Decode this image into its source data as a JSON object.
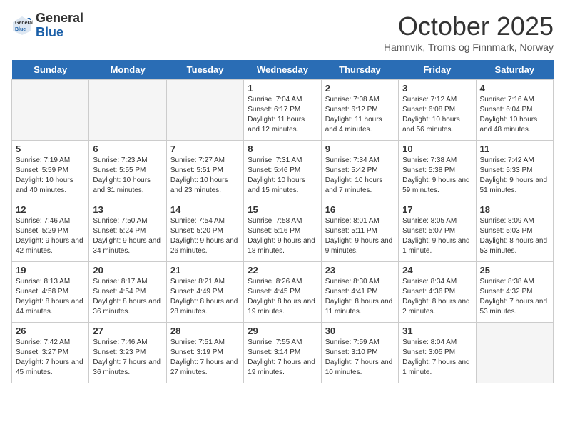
{
  "app": {
    "name": "GeneralBlue",
    "logo_text_line1": "General",
    "logo_text_line2": "Blue"
  },
  "header": {
    "month_title": "October 2025",
    "subtitle": "Hamnvik, Troms og Finnmark, Norway"
  },
  "weekdays": [
    "Sunday",
    "Monday",
    "Tuesday",
    "Wednesday",
    "Thursday",
    "Friday",
    "Saturday"
  ],
  "weeks": [
    [
      {
        "day": "",
        "sunrise": "",
        "sunset": "",
        "daylight": "",
        "empty": true
      },
      {
        "day": "",
        "sunrise": "",
        "sunset": "",
        "daylight": "",
        "empty": true
      },
      {
        "day": "",
        "sunrise": "",
        "sunset": "",
        "daylight": "",
        "empty": true
      },
      {
        "day": "1",
        "sunrise": "Sunrise: 7:04 AM",
        "sunset": "Sunset: 6:17 PM",
        "daylight": "Daylight: 11 hours and 12 minutes.",
        "empty": false
      },
      {
        "day": "2",
        "sunrise": "Sunrise: 7:08 AM",
        "sunset": "Sunset: 6:12 PM",
        "daylight": "Daylight: 11 hours and 4 minutes.",
        "empty": false
      },
      {
        "day": "3",
        "sunrise": "Sunrise: 7:12 AM",
        "sunset": "Sunset: 6:08 PM",
        "daylight": "Daylight: 10 hours and 56 minutes.",
        "empty": false
      },
      {
        "day": "4",
        "sunrise": "Sunrise: 7:16 AM",
        "sunset": "Sunset: 6:04 PM",
        "daylight": "Daylight: 10 hours and 48 minutes.",
        "empty": false
      }
    ],
    [
      {
        "day": "5",
        "sunrise": "Sunrise: 7:19 AM",
        "sunset": "Sunset: 5:59 PM",
        "daylight": "Daylight: 10 hours and 40 minutes.",
        "empty": false
      },
      {
        "day": "6",
        "sunrise": "Sunrise: 7:23 AM",
        "sunset": "Sunset: 5:55 PM",
        "daylight": "Daylight: 10 hours and 31 minutes.",
        "empty": false
      },
      {
        "day": "7",
        "sunrise": "Sunrise: 7:27 AM",
        "sunset": "Sunset: 5:51 PM",
        "daylight": "Daylight: 10 hours and 23 minutes.",
        "empty": false
      },
      {
        "day": "8",
        "sunrise": "Sunrise: 7:31 AM",
        "sunset": "Sunset: 5:46 PM",
        "daylight": "Daylight: 10 hours and 15 minutes.",
        "empty": false
      },
      {
        "day": "9",
        "sunrise": "Sunrise: 7:34 AM",
        "sunset": "Sunset: 5:42 PM",
        "daylight": "Daylight: 10 hours and 7 minutes.",
        "empty": false
      },
      {
        "day": "10",
        "sunrise": "Sunrise: 7:38 AM",
        "sunset": "Sunset: 5:38 PM",
        "daylight": "Daylight: 9 hours and 59 minutes.",
        "empty": false
      },
      {
        "day": "11",
        "sunrise": "Sunrise: 7:42 AM",
        "sunset": "Sunset: 5:33 PM",
        "daylight": "Daylight: 9 hours and 51 minutes.",
        "empty": false
      }
    ],
    [
      {
        "day": "12",
        "sunrise": "Sunrise: 7:46 AM",
        "sunset": "Sunset: 5:29 PM",
        "daylight": "Daylight: 9 hours and 42 minutes.",
        "empty": false
      },
      {
        "day": "13",
        "sunrise": "Sunrise: 7:50 AM",
        "sunset": "Sunset: 5:24 PM",
        "daylight": "Daylight: 9 hours and 34 minutes.",
        "empty": false
      },
      {
        "day": "14",
        "sunrise": "Sunrise: 7:54 AM",
        "sunset": "Sunset: 5:20 PM",
        "daylight": "Daylight: 9 hours and 26 minutes.",
        "empty": false
      },
      {
        "day": "15",
        "sunrise": "Sunrise: 7:58 AM",
        "sunset": "Sunset: 5:16 PM",
        "daylight": "Daylight: 9 hours and 18 minutes.",
        "empty": false
      },
      {
        "day": "16",
        "sunrise": "Sunrise: 8:01 AM",
        "sunset": "Sunset: 5:11 PM",
        "daylight": "Daylight: 9 hours and 9 minutes.",
        "empty": false
      },
      {
        "day": "17",
        "sunrise": "Sunrise: 8:05 AM",
        "sunset": "Sunset: 5:07 PM",
        "daylight": "Daylight: 9 hours and 1 minute.",
        "empty": false
      },
      {
        "day": "18",
        "sunrise": "Sunrise: 8:09 AM",
        "sunset": "Sunset: 5:03 PM",
        "daylight": "Daylight: 8 hours and 53 minutes.",
        "empty": false
      }
    ],
    [
      {
        "day": "19",
        "sunrise": "Sunrise: 8:13 AM",
        "sunset": "Sunset: 4:58 PM",
        "daylight": "Daylight: 8 hours and 44 minutes.",
        "empty": false
      },
      {
        "day": "20",
        "sunrise": "Sunrise: 8:17 AM",
        "sunset": "Sunset: 4:54 PM",
        "daylight": "Daylight: 8 hours and 36 minutes.",
        "empty": false
      },
      {
        "day": "21",
        "sunrise": "Sunrise: 8:21 AM",
        "sunset": "Sunset: 4:49 PM",
        "daylight": "Daylight: 8 hours and 28 minutes.",
        "empty": false
      },
      {
        "day": "22",
        "sunrise": "Sunrise: 8:26 AM",
        "sunset": "Sunset: 4:45 PM",
        "daylight": "Daylight: 8 hours and 19 minutes.",
        "empty": false
      },
      {
        "day": "23",
        "sunrise": "Sunrise: 8:30 AM",
        "sunset": "Sunset: 4:41 PM",
        "daylight": "Daylight: 8 hours and 11 minutes.",
        "empty": false
      },
      {
        "day": "24",
        "sunrise": "Sunrise: 8:34 AM",
        "sunset": "Sunset: 4:36 PM",
        "daylight": "Daylight: 8 hours and 2 minutes.",
        "empty": false
      },
      {
        "day": "25",
        "sunrise": "Sunrise: 8:38 AM",
        "sunset": "Sunset: 4:32 PM",
        "daylight": "Daylight: 7 hours and 53 minutes.",
        "empty": false
      }
    ],
    [
      {
        "day": "26",
        "sunrise": "Sunrise: 7:42 AM",
        "sunset": "Sunset: 3:27 PM",
        "daylight": "Daylight: 7 hours and 45 minutes.",
        "empty": false
      },
      {
        "day": "27",
        "sunrise": "Sunrise: 7:46 AM",
        "sunset": "Sunset: 3:23 PM",
        "daylight": "Daylight: 7 hours and 36 minutes.",
        "empty": false
      },
      {
        "day": "28",
        "sunrise": "Sunrise: 7:51 AM",
        "sunset": "Sunset: 3:19 PM",
        "daylight": "Daylight: 7 hours and 27 minutes.",
        "empty": false
      },
      {
        "day": "29",
        "sunrise": "Sunrise: 7:55 AM",
        "sunset": "Sunset: 3:14 PM",
        "daylight": "Daylight: 7 hours and 19 minutes.",
        "empty": false
      },
      {
        "day": "30",
        "sunrise": "Sunrise: 7:59 AM",
        "sunset": "Sunset: 3:10 PM",
        "daylight": "Daylight: 7 hours and 10 minutes.",
        "empty": false
      },
      {
        "day": "31",
        "sunrise": "Sunrise: 8:04 AM",
        "sunset": "Sunset: 3:05 PM",
        "daylight": "Daylight: 7 hours and 1 minute.",
        "empty": false
      },
      {
        "day": "",
        "sunrise": "",
        "sunset": "",
        "daylight": "",
        "empty": true
      }
    ]
  ]
}
